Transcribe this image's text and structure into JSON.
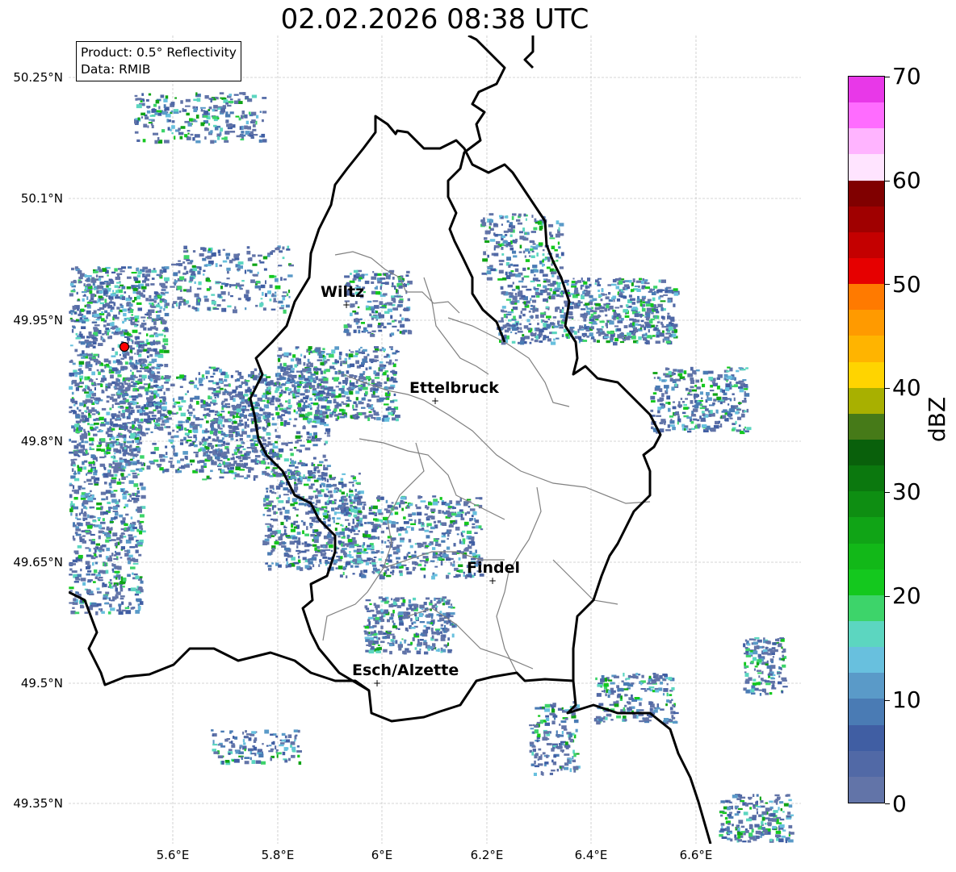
{
  "title": "02.02.2026 08:38 UTC",
  "info_box": {
    "line1": "Product: 0.5° Reflectivity",
    "line2": "Data: RMIB"
  },
  "lat_labels": [
    "50.25°N",
    "50.1°N",
    "49.95°N",
    "49.8°N",
    "49.65°N",
    "49.5°N",
    "49.35°N"
  ],
  "lon_labels": [
    "5.6°E",
    "5.8°E",
    "6°E",
    "6.2°E",
    "6.4°E",
    "6.6°E"
  ],
  "cities": [
    {
      "name": "Wiltz",
      "marker": "+"
    },
    {
      "name": "Ettelbruck",
      "marker": "+"
    },
    {
      "name": "Findel",
      "marker": "+"
    },
    {
      "name": "Esch/Alzette",
      "marker": "+"
    }
  ],
  "radar_site_color": "#ff0000",
  "colorbar": {
    "unit": "dBZ",
    "ticks": [
      "0",
      "10",
      "20",
      "30",
      "40",
      "50",
      "60",
      "70"
    ],
    "colors": [
      "#6274a8",
      "#5169a6",
      "#405ea3",
      "#4a7bb4",
      "#5a9ac8",
      "#68c0de",
      "#5cd6c0",
      "#3dd46a",
      "#14c81e",
      "#12b818",
      "#10a416",
      "#0e8e12",
      "#0b780e",
      "#09600b",
      "#467a18",
      "#a8b000",
      "#ffd400",
      "#ffb400",
      "#ff9a00",
      "#ff7a00",
      "#e60000",
      "#c40000",
      "#a00000",
      "#800000",
      "#ffe4ff",
      "#ffb4ff",
      "#ff6cff",
      "#e838e8"
    ]
  }
}
